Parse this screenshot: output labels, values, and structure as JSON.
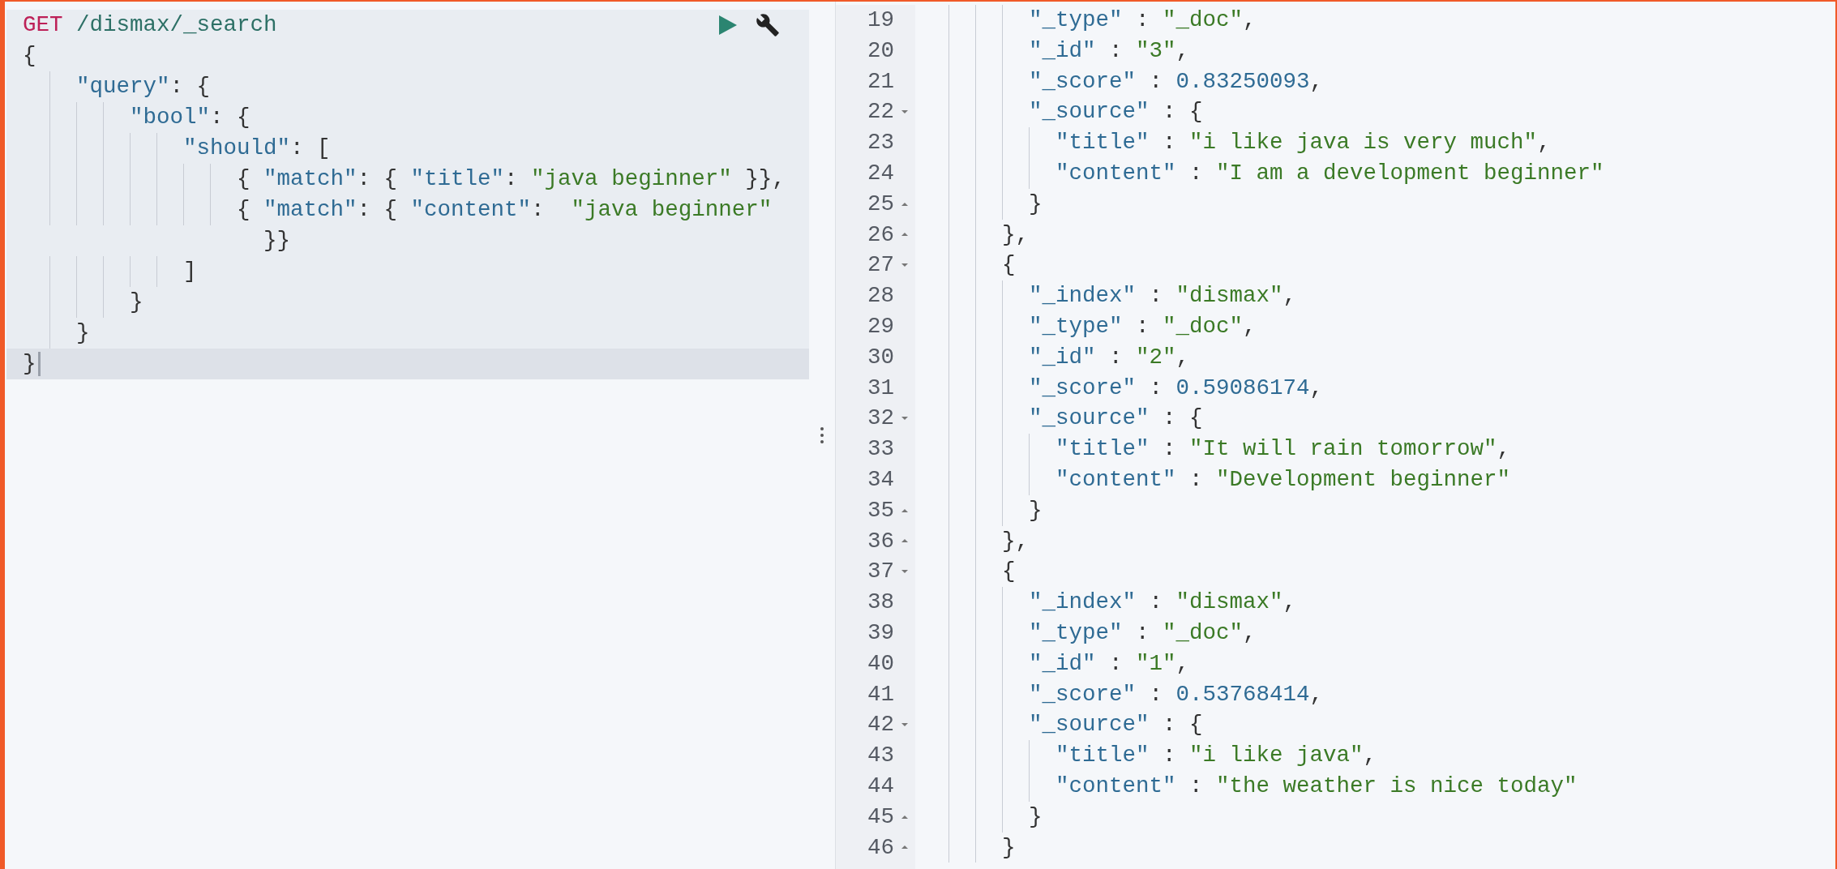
{
  "request": {
    "method": "GET",
    "path": "/dismax/_search"
  },
  "editor_lines": [
    {
      "current": false,
      "segs": [
        {
          "kind": "punct",
          "t": "{"
        }
      ]
    },
    {
      "current": false,
      "indent": [
        {
          "guide": false
        },
        {
          "guide": true
        }
      ],
      "segs": [
        {
          "kind": "key",
          "t": "\"query\""
        },
        {
          "kind": "punct",
          "t": ": {"
        }
      ]
    },
    {
      "current": false,
      "indent": [
        {
          "guide": false
        },
        {
          "guide": true
        },
        {
          "guide": true
        },
        {
          "guide": true
        }
      ],
      "segs": [
        {
          "kind": "key",
          "t": "\"bool\""
        },
        {
          "kind": "punct",
          "t": ": {"
        }
      ]
    },
    {
      "current": false,
      "indent": [
        {
          "guide": false
        },
        {
          "guide": true
        },
        {
          "guide": true
        },
        {
          "guide": true
        },
        {
          "guide": true
        },
        {
          "guide": true
        }
      ],
      "segs": [
        {
          "kind": "key",
          "t": "\"should\""
        },
        {
          "kind": "punct",
          "t": ": ["
        }
      ]
    },
    {
      "current": false,
      "indent": [
        {
          "guide": false
        },
        {
          "guide": true
        },
        {
          "guide": true
        },
        {
          "guide": true
        },
        {
          "guide": true
        },
        {
          "guide": true
        },
        {
          "guide": true
        },
        {
          "guide": true
        }
      ],
      "segs": [
        {
          "kind": "punct",
          "t": "{ "
        },
        {
          "kind": "key",
          "t": "\"match\""
        },
        {
          "kind": "punct",
          "t": ": { "
        },
        {
          "kind": "key",
          "t": "\"title\""
        },
        {
          "kind": "punct",
          "t": ": "
        },
        {
          "kind": "string",
          "t": "\"java beginner\""
        },
        {
          "kind": "punct",
          "t": " }},"
        }
      ]
    },
    {
      "current": false,
      "indent": [
        {
          "guide": false
        },
        {
          "guide": true
        },
        {
          "guide": true
        },
        {
          "guide": true
        },
        {
          "guide": true
        },
        {
          "guide": true
        },
        {
          "guide": true
        },
        {
          "guide": true
        }
      ],
      "segs": [
        {
          "kind": "punct",
          "t": "{ "
        },
        {
          "kind": "key",
          "t": "\"match\""
        },
        {
          "kind": "punct",
          "t": ": { "
        },
        {
          "kind": "key",
          "t": "\"content\""
        },
        {
          "kind": "punct",
          "t": ":  "
        },
        {
          "kind": "string",
          "t": "\"java beginner\""
        }
      ]
    },
    {
      "current": false,
      "indent": [
        {
          "guide": false
        },
        {
          "guide": false
        },
        {
          "guide": false
        },
        {
          "guide": false
        },
        {
          "guide": false
        },
        {
          "guide": false
        },
        {
          "guide": false
        },
        {
          "guide": false
        },
        {
          "guide": false
        }
      ],
      "segs": [
        {
          "kind": "punct",
          "t": "}}"
        }
      ]
    },
    {
      "current": false,
      "indent": [
        {
          "guide": false
        },
        {
          "guide": true
        },
        {
          "guide": true
        },
        {
          "guide": true
        },
        {
          "guide": true
        },
        {
          "guide": true
        }
      ],
      "segs": [
        {
          "kind": "punct",
          "t": "]"
        }
      ]
    },
    {
      "current": false,
      "indent": [
        {
          "guide": false
        },
        {
          "guide": true
        },
        {
          "guide": true
        },
        {
          "guide": true
        }
      ],
      "segs": [
        {
          "kind": "punct",
          "t": "}"
        }
      ]
    },
    {
      "current": false,
      "indent": [
        {
          "guide": false
        },
        {
          "guide": true
        }
      ],
      "segs": [
        {
          "kind": "punct",
          "t": "}"
        }
      ]
    },
    {
      "current": true,
      "segs": [
        {
          "kind": "punct",
          "t": "}"
        }
      ]
    }
  ],
  "output_lines": [
    {
      "number": "19",
      "indent": [
        {
          "guide": false
        },
        {
          "guide": true
        },
        {
          "guide": true
        },
        {
          "guide": true
        }
      ],
      "segs": [
        {
          "kind": "key",
          "t": "\"_type\""
        },
        {
          "kind": "punct",
          "t": " : "
        },
        {
          "kind": "string",
          "t": "\"_doc\""
        },
        {
          "kind": "punct",
          "t": ","
        }
      ]
    },
    {
      "number": "20",
      "indent": [
        {
          "guide": false
        },
        {
          "guide": true
        },
        {
          "guide": true
        },
        {
          "guide": true
        }
      ],
      "segs": [
        {
          "kind": "key",
          "t": "\"_id\""
        },
        {
          "kind": "punct",
          "t": " : "
        },
        {
          "kind": "string",
          "t": "\"3\""
        },
        {
          "kind": "punct",
          "t": ","
        }
      ]
    },
    {
      "number": "21",
      "indent": [
        {
          "guide": false
        },
        {
          "guide": true
        },
        {
          "guide": true
        },
        {
          "guide": true
        }
      ],
      "segs": [
        {
          "kind": "key",
          "t": "\"_score\""
        },
        {
          "kind": "punct",
          "t": " : "
        },
        {
          "kind": "number",
          "t": "0.83250093"
        },
        {
          "kind": "punct",
          "t": ","
        }
      ]
    },
    {
      "number": "22",
      "expanded": true,
      "indent": [
        {
          "guide": false
        },
        {
          "guide": true
        },
        {
          "guide": true
        },
        {
          "guide": true
        }
      ],
      "segs": [
        {
          "kind": "key",
          "t": "\"_source\""
        },
        {
          "kind": "punct",
          "t": " : {"
        }
      ]
    },
    {
      "number": "23",
      "indent": [
        {
          "guide": false
        },
        {
          "guide": true
        },
        {
          "guide": true
        },
        {
          "guide": true
        },
        {
          "guide": true
        }
      ],
      "segs": [
        {
          "kind": "key",
          "t": "\"title\""
        },
        {
          "kind": "punct",
          "t": " : "
        },
        {
          "kind": "string",
          "t": "\"i like java is very much\""
        },
        {
          "kind": "punct",
          "t": ","
        }
      ]
    },
    {
      "number": "24",
      "indent": [
        {
          "guide": false
        },
        {
          "guide": true
        },
        {
          "guide": true
        },
        {
          "guide": true
        },
        {
          "guide": true
        }
      ],
      "segs": [
        {
          "kind": "key",
          "t": "\"content\""
        },
        {
          "kind": "punct",
          "t": " : "
        },
        {
          "kind": "string",
          "t": "\"I am a development beginner\""
        }
      ]
    },
    {
      "number": "25",
      "expanded": false,
      "indent": [
        {
          "guide": false
        },
        {
          "guide": true
        },
        {
          "guide": true
        },
        {
          "guide": true
        }
      ],
      "segs": [
        {
          "kind": "punct",
          "t": "}"
        }
      ]
    },
    {
      "number": "26",
      "expanded": false,
      "indent": [
        {
          "guide": false
        },
        {
          "guide": true
        },
        {
          "guide": true
        }
      ],
      "segs": [
        {
          "kind": "punct",
          "t": "},"
        }
      ]
    },
    {
      "number": "27",
      "expanded": true,
      "indent": [
        {
          "guide": false
        },
        {
          "guide": true
        },
        {
          "guide": true
        }
      ],
      "segs": [
        {
          "kind": "punct",
          "t": "{"
        }
      ]
    },
    {
      "number": "28",
      "indent": [
        {
          "guide": false
        },
        {
          "guide": true
        },
        {
          "guide": true
        },
        {
          "guide": true
        }
      ],
      "segs": [
        {
          "kind": "key",
          "t": "\"_index\""
        },
        {
          "kind": "punct",
          "t": " : "
        },
        {
          "kind": "string",
          "t": "\"dismax\""
        },
        {
          "kind": "punct",
          "t": ","
        }
      ]
    },
    {
      "number": "29",
      "indent": [
        {
          "guide": false
        },
        {
          "guide": true
        },
        {
          "guide": true
        },
        {
          "guide": true
        }
      ],
      "segs": [
        {
          "kind": "key",
          "t": "\"_type\""
        },
        {
          "kind": "punct",
          "t": " : "
        },
        {
          "kind": "string",
          "t": "\"_doc\""
        },
        {
          "kind": "punct",
          "t": ","
        }
      ]
    },
    {
      "number": "30",
      "indent": [
        {
          "guide": false
        },
        {
          "guide": true
        },
        {
          "guide": true
        },
        {
          "guide": true
        }
      ],
      "segs": [
        {
          "kind": "key",
          "t": "\"_id\""
        },
        {
          "kind": "punct",
          "t": " : "
        },
        {
          "kind": "string",
          "t": "\"2\""
        },
        {
          "kind": "punct",
          "t": ","
        }
      ]
    },
    {
      "number": "31",
      "indent": [
        {
          "guide": false
        },
        {
          "guide": true
        },
        {
          "guide": true
        },
        {
          "guide": true
        }
      ],
      "segs": [
        {
          "kind": "key",
          "t": "\"_score\""
        },
        {
          "kind": "punct",
          "t": " : "
        },
        {
          "kind": "number",
          "t": "0.59086174"
        },
        {
          "kind": "punct",
          "t": ","
        }
      ]
    },
    {
      "number": "32",
      "expanded": true,
      "indent": [
        {
          "guide": false
        },
        {
          "guide": true
        },
        {
          "guide": true
        },
        {
          "guide": true
        }
      ],
      "segs": [
        {
          "kind": "key",
          "t": "\"_source\""
        },
        {
          "kind": "punct",
          "t": " : {"
        }
      ]
    },
    {
      "number": "33",
      "indent": [
        {
          "guide": false
        },
        {
          "guide": true
        },
        {
          "guide": true
        },
        {
          "guide": true
        },
        {
          "guide": true
        }
      ],
      "segs": [
        {
          "kind": "key",
          "t": "\"title\""
        },
        {
          "kind": "punct",
          "t": " : "
        },
        {
          "kind": "string",
          "t": "\"It will rain tomorrow\""
        },
        {
          "kind": "punct",
          "t": ","
        }
      ]
    },
    {
      "number": "34",
      "indent": [
        {
          "guide": false
        },
        {
          "guide": true
        },
        {
          "guide": true
        },
        {
          "guide": true
        },
        {
          "guide": true
        }
      ],
      "segs": [
        {
          "kind": "key",
          "t": "\"content\""
        },
        {
          "kind": "punct",
          "t": " : "
        },
        {
          "kind": "string",
          "t": "\"Development beginner\""
        }
      ]
    },
    {
      "number": "35",
      "expanded": false,
      "indent": [
        {
          "guide": false
        },
        {
          "guide": true
        },
        {
          "guide": true
        },
        {
          "guide": true
        }
      ],
      "segs": [
        {
          "kind": "punct",
          "t": "}"
        }
      ]
    },
    {
      "number": "36",
      "expanded": false,
      "indent": [
        {
          "guide": false
        },
        {
          "guide": true
        },
        {
          "guide": true
        }
      ],
      "segs": [
        {
          "kind": "punct",
          "t": "},"
        }
      ]
    },
    {
      "number": "37",
      "expanded": true,
      "indent": [
        {
          "guide": false
        },
        {
          "guide": true
        },
        {
          "guide": true
        }
      ],
      "segs": [
        {
          "kind": "punct",
          "t": "{"
        }
      ]
    },
    {
      "number": "38",
      "indent": [
        {
          "guide": false
        },
        {
          "guide": true
        },
        {
          "guide": true
        },
        {
          "guide": true
        }
      ],
      "segs": [
        {
          "kind": "key",
          "t": "\"_index\""
        },
        {
          "kind": "punct",
          "t": " : "
        },
        {
          "kind": "string",
          "t": "\"dismax\""
        },
        {
          "kind": "punct",
          "t": ","
        }
      ]
    },
    {
      "number": "39",
      "indent": [
        {
          "guide": false
        },
        {
          "guide": true
        },
        {
          "guide": true
        },
        {
          "guide": true
        }
      ],
      "segs": [
        {
          "kind": "key",
          "t": "\"_type\""
        },
        {
          "kind": "punct",
          "t": " : "
        },
        {
          "kind": "string",
          "t": "\"_doc\""
        },
        {
          "kind": "punct",
          "t": ","
        }
      ]
    },
    {
      "number": "40",
      "indent": [
        {
          "guide": false
        },
        {
          "guide": true
        },
        {
          "guide": true
        },
        {
          "guide": true
        }
      ],
      "segs": [
        {
          "kind": "key",
          "t": "\"_id\""
        },
        {
          "kind": "punct",
          "t": " : "
        },
        {
          "kind": "string",
          "t": "\"1\""
        },
        {
          "kind": "punct",
          "t": ","
        }
      ]
    },
    {
      "number": "41",
      "indent": [
        {
          "guide": false
        },
        {
          "guide": true
        },
        {
          "guide": true
        },
        {
          "guide": true
        }
      ],
      "segs": [
        {
          "kind": "key",
          "t": "\"_score\""
        },
        {
          "kind": "punct",
          "t": " : "
        },
        {
          "kind": "number",
          "t": "0.53768414"
        },
        {
          "kind": "punct",
          "t": ","
        }
      ]
    },
    {
      "number": "42",
      "expanded": true,
      "indent": [
        {
          "guide": false
        },
        {
          "guide": true
        },
        {
          "guide": true
        },
        {
          "guide": true
        }
      ],
      "segs": [
        {
          "kind": "key",
          "t": "\"_source\""
        },
        {
          "kind": "punct",
          "t": " : {"
        }
      ]
    },
    {
      "number": "43",
      "indent": [
        {
          "guide": false
        },
        {
          "guide": true
        },
        {
          "guide": true
        },
        {
          "guide": true
        },
        {
          "guide": true
        }
      ],
      "segs": [
        {
          "kind": "key",
          "t": "\"title\""
        },
        {
          "kind": "punct",
          "t": " : "
        },
        {
          "kind": "string",
          "t": "\"i like java\""
        },
        {
          "kind": "punct",
          "t": ","
        }
      ]
    },
    {
      "number": "44",
      "indent": [
        {
          "guide": false
        },
        {
          "guide": true
        },
        {
          "guide": true
        },
        {
          "guide": true
        },
        {
          "guide": true
        }
      ],
      "segs": [
        {
          "kind": "key",
          "t": "\"content\""
        },
        {
          "kind": "punct",
          "t": " : "
        },
        {
          "kind": "string",
          "t": "\"the weather is nice today\""
        }
      ]
    },
    {
      "number": "45",
      "expanded": false,
      "indent": [
        {
          "guide": false
        },
        {
          "guide": true
        },
        {
          "guide": true
        },
        {
          "guide": true
        }
      ],
      "segs": [
        {
          "kind": "punct",
          "t": "}"
        }
      ]
    },
    {
      "number": "46",
      "expanded": false,
      "indent": [
        {
          "guide": false
        },
        {
          "guide": true
        },
        {
          "guide": true
        }
      ],
      "segs": [
        {
          "kind": "punct",
          "t": "}"
        }
      ]
    }
  ]
}
